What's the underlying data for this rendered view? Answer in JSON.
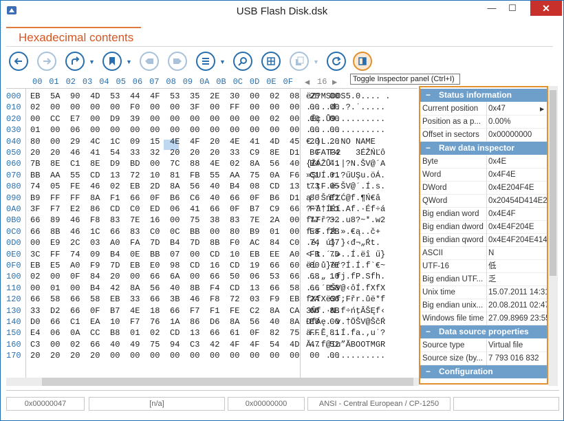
{
  "window": {
    "title": "USB Flash Disk.dsk",
    "minimize_glyph": "—",
    "maximize_glyph": "☐",
    "close_glyph": "✕"
  },
  "panel": {
    "title": "Hexadecimal contents"
  },
  "toolbar": {
    "buttons": [
      {
        "name": "back-icon"
      },
      {
        "name": "forward-icon"
      },
      {
        "name": "go-to-icon"
      },
      {
        "name": "bookmark-icon"
      },
      {
        "name": "prev-bookmark-icon"
      },
      {
        "name": "next-bookmark-icon"
      },
      {
        "name": "list-icon"
      },
      {
        "name": "search-icon"
      },
      {
        "name": "grid-icon"
      },
      {
        "name": "copy-icon"
      },
      {
        "name": "refresh-icon"
      },
      {
        "name": "inspector-panel-icon"
      }
    ],
    "tooltip": "Toggle Inspector panel (Ctrl+I)"
  },
  "hex": {
    "columns": [
      "00",
      "01",
      "02",
      "03",
      "04",
      "05",
      "06",
      "07",
      "08",
      "09",
      "0A",
      "0B",
      "0C",
      "0D",
      "0E",
      "0F"
    ],
    "text_width": "16",
    "text_prev": "◀",
    "text_next": "▶",
    "rows": [
      {
        "addr": "000",
        "bytes": "EB 5A 90 4D 53 44 4F 53 35 2E 30 00 02 08 20 00",
        "text": "ëZ?MSDOS5.0.... ."
      },
      {
        "addr": "010",
        "bytes": "02 00 00 00 00 F0 00 00 3F 00 FF 00 00 00 00 00",
        "text": ".....đ..?.˙....."
      },
      {
        "addr": "020",
        "bytes": "00 CC E7 00 D9 39 00 00 00 00 00 00 02 00 00 00",
        "text": ".Ěç.Ů9.........."
      },
      {
        "addr": "030",
        "bytes": "01 00 06 00 00 00 00 00 00 00 00 00 00 00 00 00",
        "text": "................"
      },
      {
        "addr": "040",
        "bytes": "80 00 29 4C 1C 09 15 4E 4F 20 4E 41 4D 45 20 20",
        "text": "€.)L...NO NAME  "
      },
      {
        "addr": "050",
        "bytes": "20 20 46 41 54 33 32 20 20 20 33 C9 8E D1 BC F4",
        "text": "  FAT32   3ÉŽŃĽô"
      },
      {
        "addr": "060",
        "bytes": "7B 8E C1 8E D9 BD 00 7C 88 4E 02 8A 56 40 B4 41",
        "text": "{ŽÁŽŮ˝.|?N.ŠV@´A"
      },
      {
        "addr": "070",
        "bytes": "BB AA 55 CD 13 72 10 81 FB 55 AA 75 0A F6 C1 01",
        "text": "»ŞUÍ.r.?űUŞu.öÁ."
      },
      {
        "addr": "080",
        "bytes": "74 05 FE 46 02 EB 2D 8A 56 40 B4 08 CD 13 73 05",
        "text": "t.ţF.ë-ŠV@´.Í.s."
      },
      {
        "addr": "090",
        "bytes": "B9 FF FF 8A F1 66 0F B6 C6 40 66 0F B6 D1 80 E2",
        "text": "ą˙˙ŠńfĽĆ@f.¶Ń€â"
      },
      {
        "addr": "0A0",
        "bytes": "3F F7 E2 86 CD C0 ED 06 41 66 0F B7 C9 66 F7 E1",
        "text": "?÷â†ÍŔí.Af.·Éf÷á"
      },
      {
        "addr": "0B0",
        "bytes": "66 89 46 F8 83 7E 16 00 75 38 83 7E 2A 00 77 32",
        "text": "f‰Fř?~..u8?~*.w2"
      },
      {
        "addr": "0C0",
        "bytes": "66 8B 46 1C 66 83 C0 0C BB 00 80 B9 01 00 E8 2B",
        "text": "f‹F.fŔ.».€ą..č+"
      },
      {
        "addr": "0D0",
        "bytes": "00 E9 2C 03 A0 FA 7D B4 7D 8B F0 AC 84 C0 74 17",
        "text": ".é, ú}´}‹đ¬„Ŕt."
      },
      {
        "addr": "0E0",
        "bytes": "3C FF 74 09 B4 0E BB 07 00 CD 10 EB EE A0 FB 7D",
        "text": "<˙t.´.»..Í.ëî ű}"
      },
      {
        "addr": "0F0",
        "bytes": "EB E5 A0 F9 7D EB E0 98 CD 16 CD 19 66 60 80 7E",
        "text": "ëĺ ů}ëŕ?Í.Í.f`€~"
      },
      {
        "addr": "100",
        "bytes": "02 00 0F 84 20 00 66 6A 00 66 50 06 53 66 68 10",
        "text": "...„ .fj.fP.Sfh."
      },
      {
        "addr": "110",
        "bytes": "00 01 00 B4 42 8A 56 40 8B F4 CD 13 66 58 66 58",
        "text": "...´BŠV@‹ôÍ.fXfX"
      },
      {
        "addr": "120",
        "bytes": "66 58 66 58 EB 33 66 3B 46 F8 72 03 F9 EB 2A 66",
        "text": "fXfXë3f;Fřr.ůë*f"
      },
      {
        "addr": "130",
        "bytes": "33 D2 66 0F B7 4E 18 66 F7 F1 FE C2 8A CA 66 8B",
        "text": "3Ňf.·N.f÷ńţÂŠĘf‹"
      },
      {
        "addr": "140",
        "bytes": "D0 66 C1 EA 10 F7 76 1A 86 D6 8A 56 40 8A E8 C0",
        "text": "ĐfÁę.÷v.†ÖŠV@ŠčŔ"
      },
      {
        "addr": "150",
        "bytes": "E4 06 0A CC B8 01 02 CD 13 66 61 0F 82 75 FF 81",
        "text": "ä..Ě¸..Í.fa.‚u˙?"
      },
      {
        "addr": "160",
        "bytes": "C3 00 02 66 40 49 75 94 C3 42 4F 4F 54 4D 47 52",
        "text": "Ă..f@Iu”ĂBOOTMGR"
      },
      {
        "addr": "170",
        "bytes": "20 20 20 20 00 00 00 00 00 00 00 00 00 00 00 00",
        "text": "    ............"
      }
    ]
  },
  "inspector": {
    "sections": [
      {
        "title": "Status information",
        "rows": [
          {
            "name": "Current position",
            "value": "0x47"
          },
          {
            "name": "Position as a p...",
            "value": "0.00%"
          },
          {
            "name": "Offset in sectors",
            "value": "0x00000000"
          }
        ]
      },
      {
        "title": "Raw data inspector",
        "rows": [
          {
            "name": "Byte",
            "value": "0x4E"
          },
          {
            "name": "Word",
            "value": "0x4F4E"
          },
          {
            "name": "DWord",
            "value": "0x4E204F4E"
          },
          {
            "name": "QWord",
            "value": "0x20454D414E204F4E"
          },
          {
            "name": "Big endian word",
            "value": "0x4E4F"
          },
          {
            "name": "Big endian dword",
            "value": "0x4E4F204E"
          },
          {
            "name": "Big endian qword",
            "value": "0x4E4F204E414D4520"
          },
          {
            "name": "ASCII",
            "value": "N"
          },
          {
            "name": "UTF-16",
            "value": "低"
          },
          {
            "name": "Big endian UTF...",
            "value": "乏"
          },
          {
            "name": "Unix time",
            "value": "15.07.2011 14:31"
          },
          {
            "name": "Big endian unix...",
            "value": "20.08.2011 02:47"
          },
          {
            "name": "Windows file time",
            "value": "27.09.8969 23:55"
          }
        ]
      },
      {
        "title": "Data source properties",
        "rows": [
          {
            "name": "Source type",
            "value": "Virtual file"
          },
          {
            "name": "Source size (by...",
            "value": "7 793 016 832"
          }
        ]
      },
      {
        "title": "Configuration",
        "rows": []
      }
    ]
  },
  "statusbar": {
    "position": "0x00000047",
    "value": "[n/a]",
    "offset": "0x00000000",
    "encoding": "ANSI - Central European / CP-1250",
    "extra": ""
  }
}
